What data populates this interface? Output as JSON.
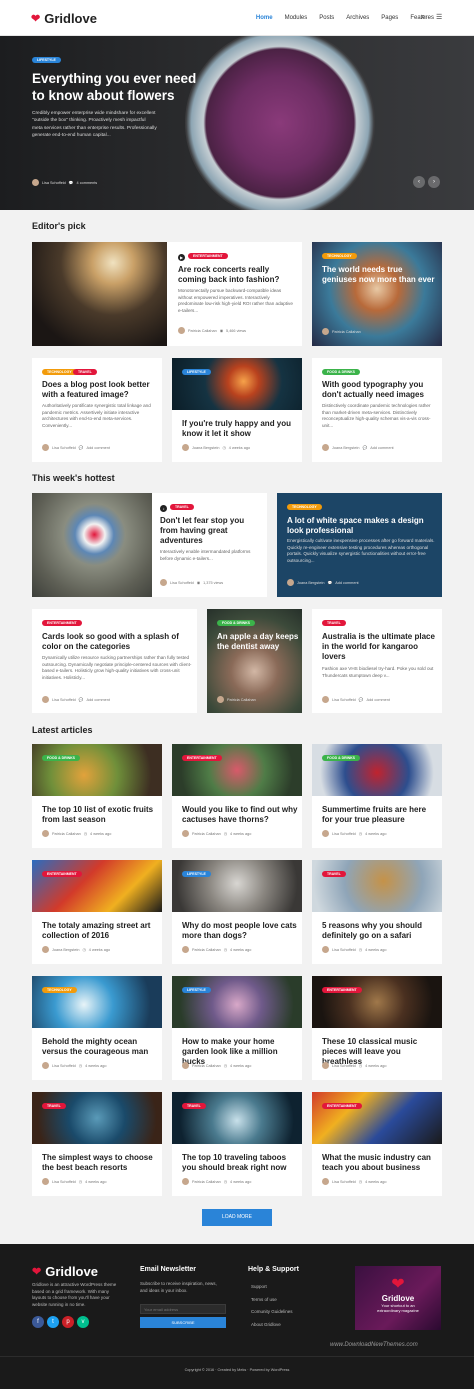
{
  "brand": "Gridlove",
  "nav": {
    "items": [
      "Home",
      "Modules",
      "Posts",
      "Archives",
      "Pages",
      "Features"
    ],
    "active": "Home",
    "search_icon": "⌕",
    "menu_icon": "☰"
  },
  "hero": {
    "tag": "Lifestyle",
    "title_line1": "Everything you ever need",
    "title_line2": "to know about flowers",
    "excerpt": [
      "Credibly empower enterprise wide mindshare for excellent",
      "\"outside the box\" thinking. Proactively mesh impactful",
      "meta services rather than enterprise results. Professionally",
      "generate end-to-end human capital..."
    ],
    "author": "Lisa Schoffeld",
    "comments": "4 comments"
  },
  "editors": {
    "heading": "Editor's pick",
    "c1": {
      "tag": "Entertainment",
      "title": "Are rock concerts really coming back into fashion?",
      "excerpt": "Monotonectally pursue backward-compatible ideas without empowered imperatives. Interactively predominate low-risk high-yield ROI rather than adaptive e-tailers...",
      "author": "Patricia Callahan",
      "views": "5,466 views"
    },
    "c2": {
      "tag": "Technology",
      "title": "The world needs true geniuses now more than ever",
      "author": "Patricia Callahan"
    },
    "c3": {
      "tags": [
        "Technology",
        "Travel"
      ],
      "title": "Does a blog post look better with a featured image?",
      "excerpt": "Authoritatively pontificate synergistic total linkage and pandemic metrics. Assertively initiate interactive architectures with end-to-end meta-services. Conveniently...",
      "author": "Lisa Schoffeld",
      "comments": "Add comment"
    },
    "c4": {
      "tag": "Lifestyle",
      "title": "If you're truly happy and you know it let it show",
      "author": "Joana Bergstein",
      "time": "4 weeks ago"
    },
    "c5": {
      "tag": "Food & Drinks",
      "title": "With good typography you don't actually need images",
      "excerpt": "Distinctively coordinate pandemic technologies rather than market-driven meta-services. Distinctively reconceptualize high-quality schemas vis-a-vis cross-unit...",
      "author": "Joana Bergstein",
      "comments": "Add comment"
    }
  },
  "hottest": {
    "heading": "This week's hottest",
    "c1": {
      "tag": "Travel",
      "title": "Don't let fear stop you from having great adventures",
      "excerpt": "Interactively enable intermandated platforms before dynamic e-tailers...",
      "author": "Lisa Schoffeld",
      "views": "1,375 views"
    },
    "c2": {
      "tag": "Technology",
      "title": "A lot of white space makes a design look professional",
      "excerpt": "Energistically cultivate inexpensive processes after go forward materials. Quickly re-engineer extensive testing procedures whereas orthogonal portals. Quickly visualize synergistic functionalities without error-free outsourcing...",
      "author": "Joana Bergstein",
      "comments": "Add comment"
    },
    "c3": {
      "tag": "Entertainment",
      "title": "Cards look so good with a splash of color on the categories",
      "excerpt": "Dynamically utilize resource sucking partnerships rather than fully tested outsourcing. Dynamically negotiate principle-centered sources with client-based e-tailers. Holisticly grow high-quality initiatives with cross-unit initiatives. Holisticly...",
      "author": "Lisa Schoffeld",
      "comments": "Add comment"
    },
    "c4": {
      "tag": "Food & Drinks",
      "title": "An apple a day keeps the dentist away",
      "author": "Patricia Callahan"
    },
    "c5": {
      "tag": "Travel",
      "title": "Australia is the ultimate place in the world for kangaroo lovers",
      "excerpt": "Fashion axe VHS biodiesel try-hard. Poke you sold out Thundercats stumptown deep v...",
      "author": "Lisa Schoffeld",
      "comments": "Add comment"
    }
  },
  "latest": {
    "heading": "Latest articles",
    "items": [
      {
        "tag": "Food & Drinks",
        "title": "The top 10 list of exotic fruits from last season",
        "author": "Patricia Callahan",
        "time": "4 weeks ago"
      },
      {
        "tag": "Entertainment",
        "title": "Would you like to find out why cactuses have thorns?",
        "author": "Patricia Callahan",
        "time": "4 weeks ago"
      },
      {
        "tag": "Food & Drinks",
        "title": "Summertime fruits are here for your true pleasure",
        "author": "Lisa Schoffeld",
        "time": "4 weeks ago"
      },
      {
        "tag": "Entertainment",
        "title": "The totaly amazing street art collection of 2016",
        "author": "Joana Bergstein",
        "time": "4 weeks ago"
      },
      {
        "tag": "Lifestyle",
        "title": "Why do most people love cats more than dogs?",
        "author": "Patricia Callahan",
        "time": "4 weeks ago"
      },
      {
        "tag": "Travel",
        "title": "5 reasons why you should definitely go on a safari",
        "author": "Lisa Schoffeld",
        "time": "4 weeks ago"
      },
      {
        "tag": "Technology",
        "title": "Behold the mighty ocean versus the courageous man",
        "author": "Lisa Schoffeld",
        "time": "4 weeks ago"
      },
      {
        "tag": "Lifestyle",
        "title": "How to make your home garden look like a million bucks",
        "author": "Patricia Callahan",
        "time": "4 weeks ago"
      },
      {
        "tag": "Entertainment",
        "title": "These 10 classical music pieces will leave you breathless",
        "author": "Lisa Schoffeld",
        "time": "4 weeks ago"
      },
      {
        "tag": "Travel",
        "title": "The simplest ways to choose the best beach resorts",
        "author": "Lisa Schoffeld",
        "time": "4 weeks ago"
      },
      {
        "tag": "Travel",
        "title": "The top 10 traveling taboos you should break right now",
        "author": "Patricia Callahan",
        "time": "4 weeks ago"
      },
      {
        "tag": "Entertainment",
        "title": "What the music industry can teach you about business",
        "author": "Lisa Schoffeld",
        "time": "4 weeks ago"
      }
    ]
  },
  "load_more": "LOAD MORE",
  "footer": {
    "about": [
      "Gridlove is an attractive WordPress theme",
      "based on a grid framework. With many",
      "layouts to choose from you'll have your",
      "website running in no time."
    ],
    "newsletter_title": "Email Newsletter",
    "newsletter_text": [
      "Subscribe to receive inspiration, news,",
      "and ideas in your inbox."
    ],
    "email_placeholder": "Your email address",
    "subscribe": "SUBSCRIBE",
    "help_title": "Help & Support",
    "help_links": [
      "Support",
      "Terms of use",
      "Comunity Guidelines",
      "About Gridlove"
    ],
    "promo_brand": "Gridlove",
    "promo_text": [
      "Your shortcut to an",
      "extraordinary magazine"
    ],
    "copyright": "Copyright © 2016 · Created by Meks · Powered by WordPress",
    "watermark": "www.DownloadNewThemes.com"
  }
}
